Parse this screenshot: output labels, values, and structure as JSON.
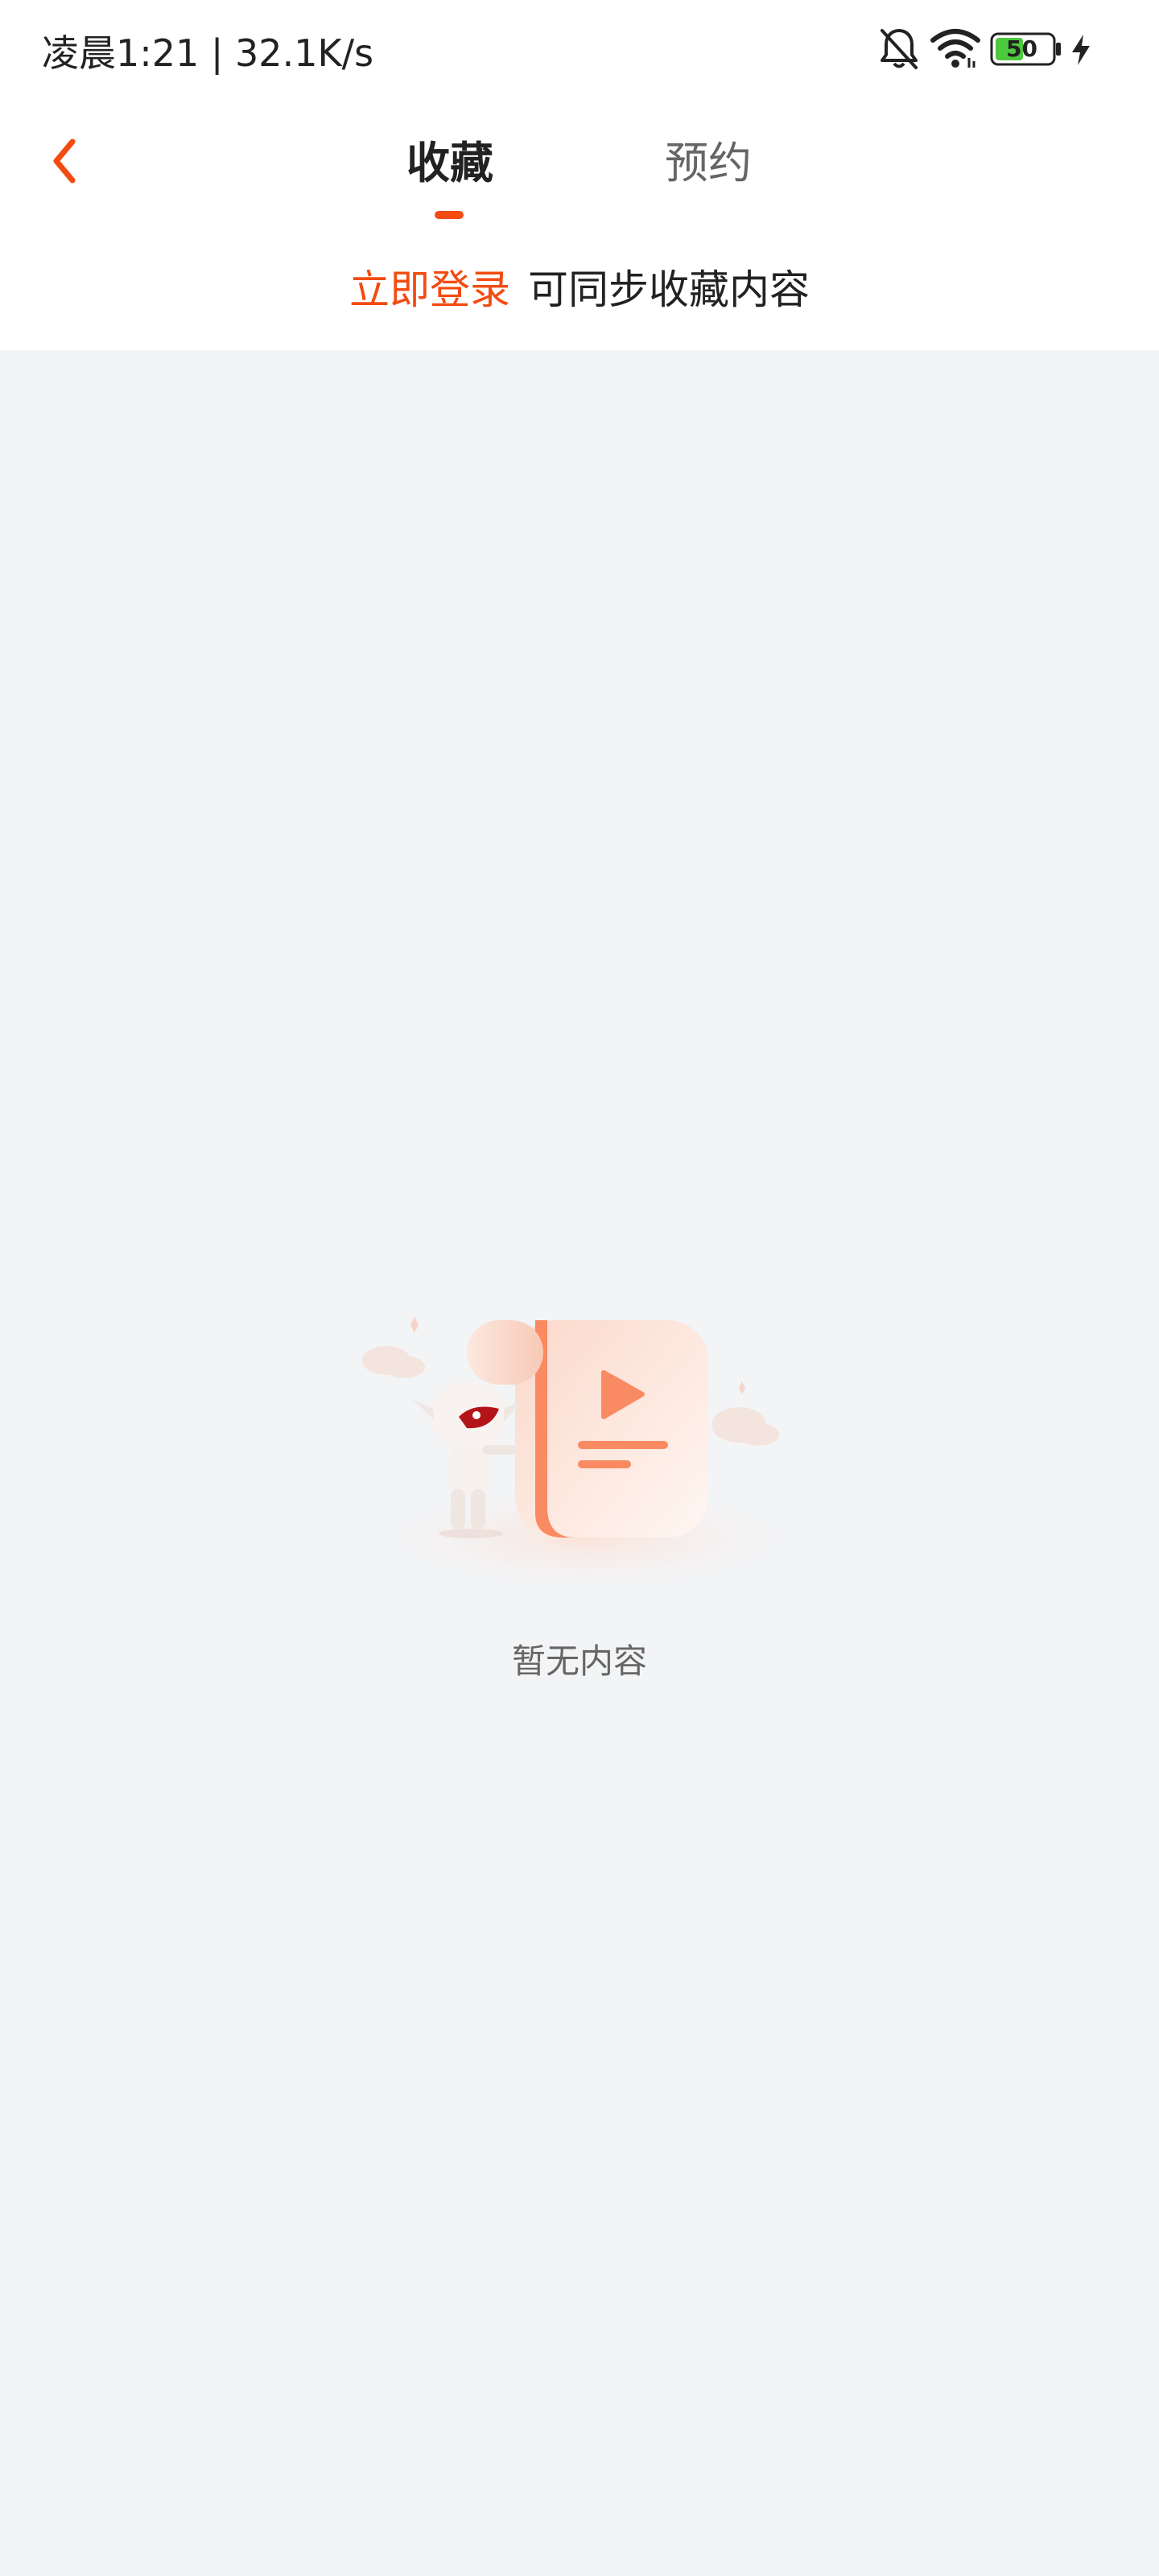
{
  "status_bar": {
    "time_speed": "凌晨1:21 | 32.1K/s",
    "battery_level": "50",
    "icons": [
      "bell-muted-icon",
      "wifi-icon",
      "battery-icon",
      "charging-icon"
    ]
  },
  "header": {
    "back_icon": "chevron-left-icon",
    "tabs": [
      {
        "label": "收藏",
        "active": true
      },
      {
        "label": "预约",
        "active": false
      }
    ]
  },
  "login_prompt": {
    "link_label": "立即登录",
    "message": "可同步收藏内容"
  },
  "empty_state": {
    "illustration": "mascot-with-video-scroll",
    "text": "暂无内容"
  },
  "colors": {
    "accent": "#f24c12",
    "background": "#f3f4f6",
    "surface": "#ffffff"
  }
}
